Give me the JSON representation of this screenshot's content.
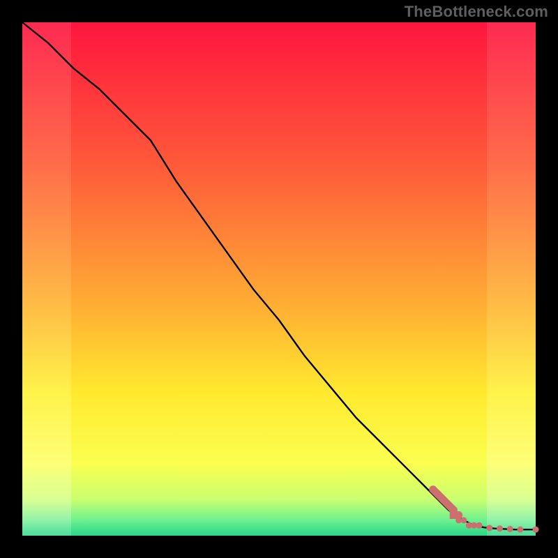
{
  "watermark": "TheBottleneck.com",
  "colors": {
    "line": "#000000",
    "marker": "#cc6f6e",
    "border": "#000000"
  },
  "chart_data": {
    "type": "line",
    "title": "",
    "xlabel": "",
    "ylabel": "",
    "xlim": [
      0,
      100
    ],
    "ylim": [
      0,
      100
    ],
    "grid": false,
    "legend": false,
    "series": [
      {
        "name": "curve",
        "x": [
          0,
          5,
          10,
          15,
          20,
          25,
          30,
          35,
          40,
          45,
          50,
          55,
          60,
          65,
          70,
          75,
          80,
          83,
          86,
          88,
          90,
          92,
          94,
          96,
          98,
          100
        ],
        "y": [
          100,
          96,
          91,
          87,
          82,
          77,
          69,
          62,
          55,
          48,
          42,
          35,
          29,
          23,
          18,
          13,
          8,
          5,
          3,
          2,
          1.6,
          1.4,
          1.3,
          1.2,
          1.2,
          1.2
        ]
      },
      {
        "name": "bottom-markers",
        "x": [
          80,
          81,
          82,
          83,
          84,
          84,
          85,
          85,
          86,
          87,
          88,
          89,
          91,
          93,
          95,
          97,
          100
        ],
        "y": [
          9,
          8,
          7,
          6,
          5,
          4,
          4,
          3,
          3,
          2,
          2,
          2,
          1.5,
          1.4,
          1.3,
          1.2,
          1.2
        ]
      }
    ],
    "background_gradient_center": [
      {
        "offset": 0.0,
        "color": "#ff153e"
      },
      {
        "offset": 0.28,
        "color": "#ff5a3a"
      },
      {
        "offset": 0.55,
        "color": "#ffad34"
      },
      {
        "offset": 0.72,
        "color": "#ffe92e"
      },
      {
        "offset": 0.86,
        "color": "#fbff50"
      },
      {
        "offset": 0.93,
        "color": "#c8ff70"
      },
      {
        "offset": 0.97,
        "color": "#6ef090"
      },
      {
        "offset": 1.0,
        "color": "#27d688"
      }
    ],
    "background_gradient_edge": [
      {
        "offset": 0.0,
        "color": "#ff2a51"
      },
      {
        "offset": 0.28,
        "color": "#ff6d4a"
      },
      {
        "offset": 0.55,
        "color": "#ffbb46"
      },
      {
        "offset": 0.72,
        "color": "#fff24a"
      },
      {
        "offset": 0.86,
        "color": "#fdff77"
      },
      {
        "offset": 0.93,
        "color": "#d8ff94"
      },
      {
        "offset": 0.97,
        "color": "#8ff3a8"
      },
      {
        "offset": 1.0,
        "color": "#4add9a"
      }
    ]
  }
}
